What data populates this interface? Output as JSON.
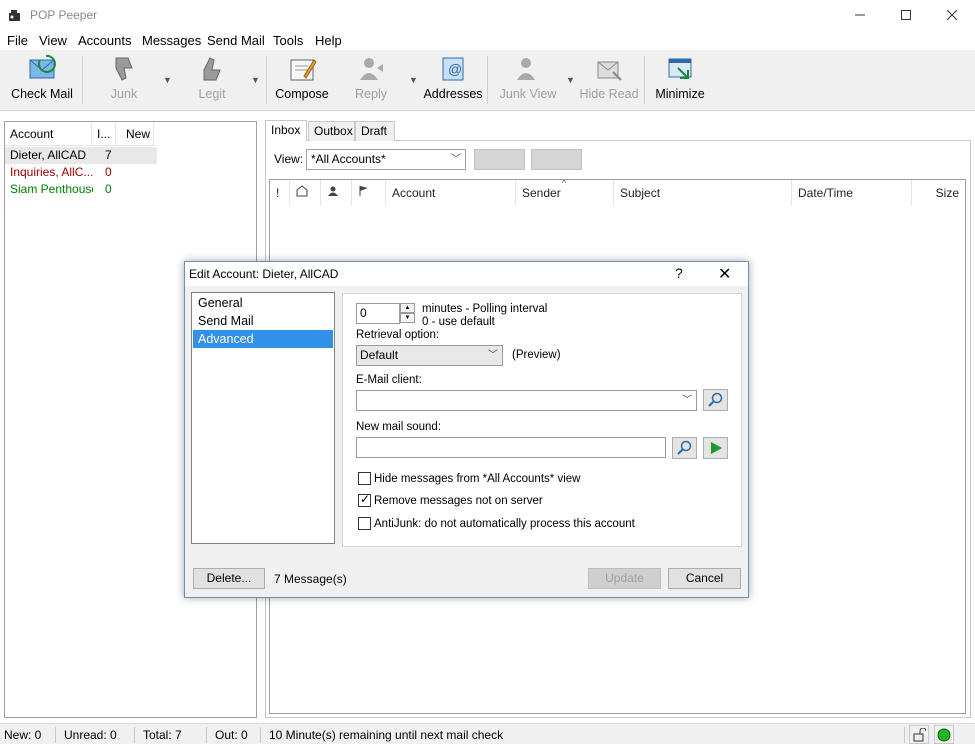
{
  "app": {
    "title": "POP Peeper"
  },
  "menu": [
    "File",
    "View",
    "Accounts",
    "Messages",
    "Send Mail",
    "Tools",
    "Help"
  ],
  "toolbar": {
    "check_mail": "Check Mail",
    "junk": "Junk",
    "legit": "Legit",
    "compose": "Compose",
    "reply": "Reply",
    "addresses": "Addresses",
    "junk_view": "Junk View",
    "hide_read": "Hide Read",
    "minimize": "Minimize"
  },
  "accounts": {
    "headers": [
      "Account",
      "I...",
      "New"
    ],
    "rows": [
      {
        "name": "Dieter, AllCAD",
        "count": "7",
        "color": "#000000"
      },
      {
        "name": "Inquiries, AllC...",
        "count": "0",
        "color": "#a00000"
      },
      {
        "name": "Siam Penthouse",
        "count": "0",
        "color": "#008000"
      }
    ]
  },
  "tabs": [
    "Inbox",
    "Outbox",
    "Draft"
  ],
  "view": {
    "label": "View:",
    "selected": "*All Accounts*"
  },
  "list_headers": {
    "flag": "!",
    "account": "Account",
    "sender": "Sender",
    "subject": "Subject",
    "datetime": "Date/Time",
    "size": "Size"
  },
  "dialog": {
    "title": "Edit Account: Dieter, AllCAD",
    "help": "?",
    "close": "✕",
    "nav": [
      "General",
      "Send Mail",
      "Advanced"
    ],
    "polling_value": "0",
    "polling_label": "minutes - Polling interval",
    "polling_hint": "0 - use default",
    "retrieval_label": "Retrieval option:",
    "retrieval_value": "Default",
    "preview": "(Preview)",
    "email_client_label": "E-Mail client:",
    "email_client_value": "",
    "sound_label": "New mail sound:",
    "sound_value": "",
    "checks": [
      {
        "label": "Hide messages from *All Accounts* view",
        "checked": false
      },
      {
        "label": "Remove messages not on server",
        "checked": true
      },
      {
        "label": "AntiJunk: do not automatically process this account",
        "checked": false
      }
    ],
    "delete_btn": "Delete...",
    "message_count": "7 Message(s)",
    "update_btn": "Update",
    "cancel_btn": "Cancel"
  },
  "status": {
    "new": "New: 0",
    "unread": "Unread: 0",
    "total": "Total: 7",
    "out": "Out: 0",
    "message": "10 Minute(s) remaining until next mail check"
  },
  "colors": {
    "selection": "#3390e8",
    "status_green": "#22b422"
  }
}
